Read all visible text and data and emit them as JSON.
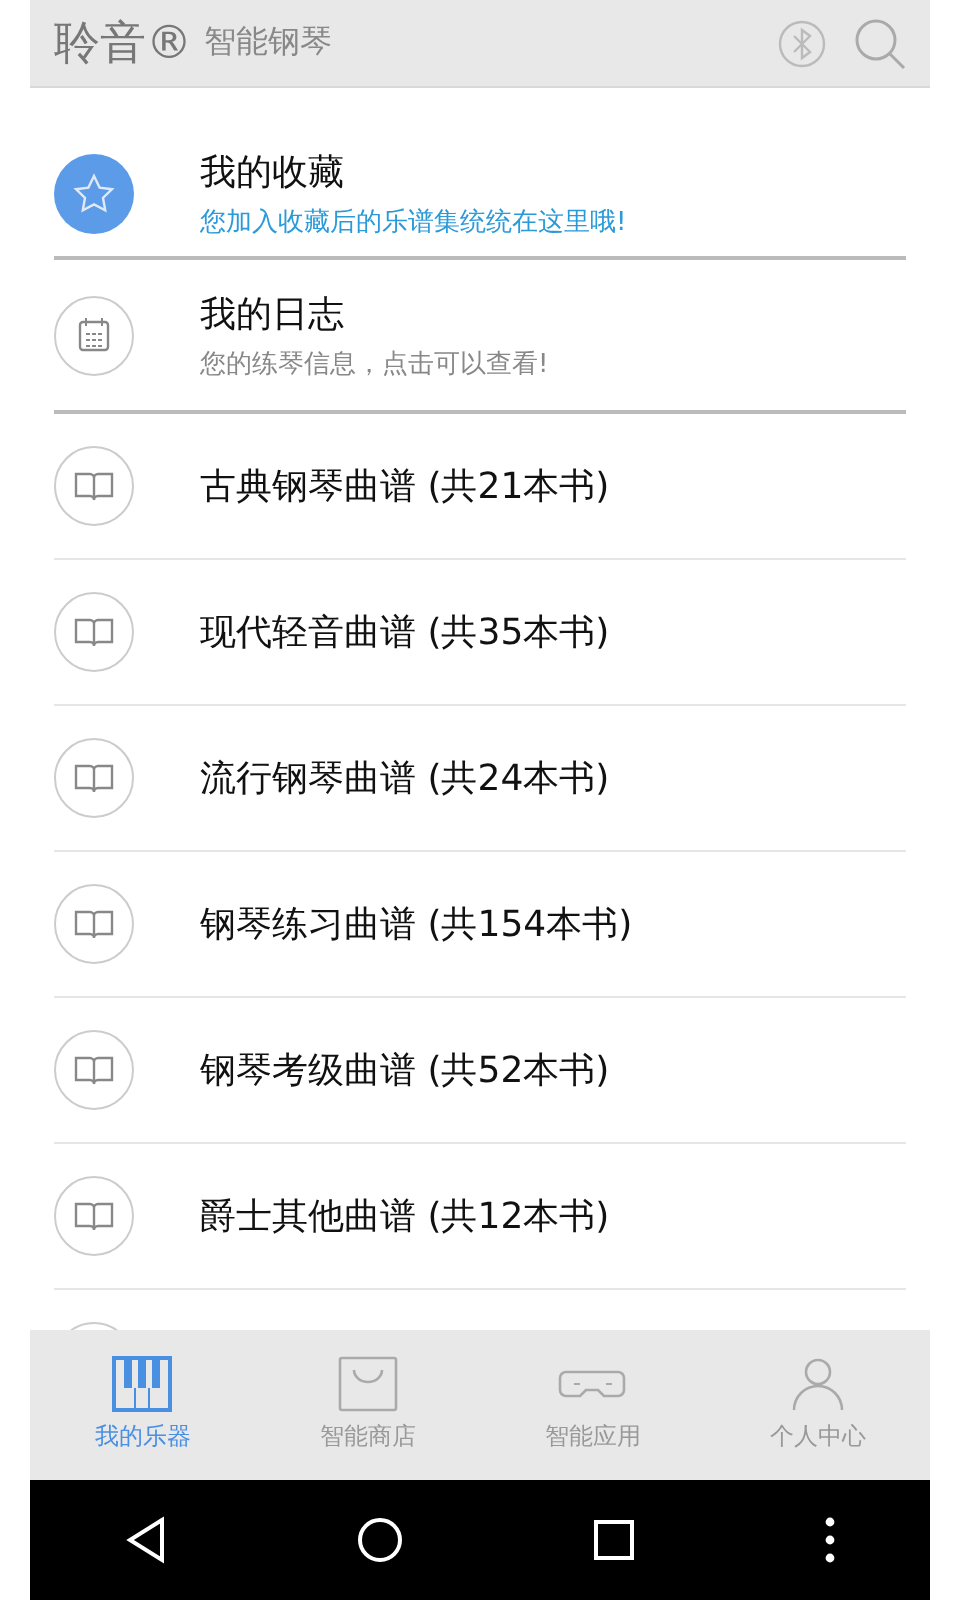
{
  "header": {
    "logo": "聆音®",
    "subtitle": "智能钢琴"
  },
  "items": [
    {
      "kind": "favorite",
      "title": "我的收藏",
      "subtitle": "您加入收藏后的乐谱集统统在这里哦!"
    },
    {
      "kind": "log",
      "title": "我的日志",
      "subtitle": "您的练琴信息，点击可以查看!"
    },
    {
      "kind": "book",
      "title": "古典钢琴曲谱 (共21本书)"
    },
    {
      "kind": "book",
      "title": "现代轻音曲谱 (共35本书)"
    },
    {
      "kind": "book",
      "title": "流行钢琴曲谱 (共24本书)"
    },
    {
      "kind": "book",
      "title": "钢琴练习曲谱 (共154本书)"
    },
    {
      "kind": "book",
      "title": "钢琴考级曲谱 (共52本书)"
    },
    {
      "kind": "book",
      "title": "爵士其他曲谱 (共12本书)"
    }
  ],
  "tabs": [
    {
      "kind": "piano",
      "label": "我的乐器",
      "selected": true
    },
    {
      "kind": "shop",
      "label": "智能商店",
      "selected": false
    },
    {
      "kind": "apps",
      "label": "智能应用",
      "selected": false
    },
    {
      "kind": "person",
      "label": "个人中心",
      "selected": false
    }
  ]
}
